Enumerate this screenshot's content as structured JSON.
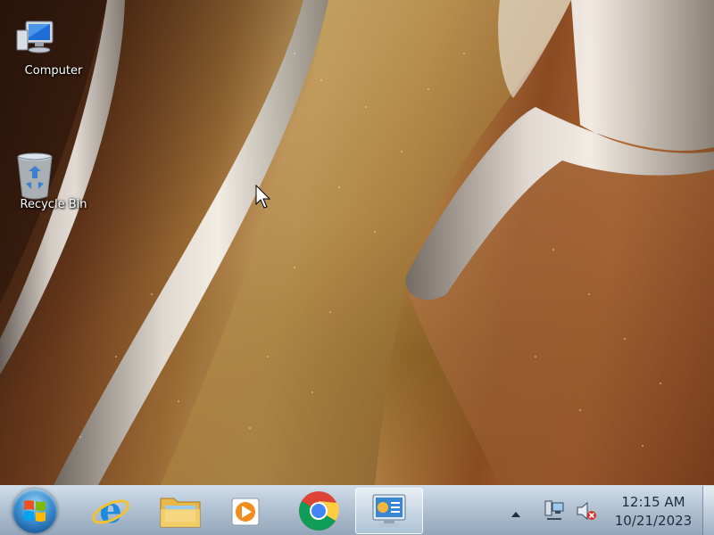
{
  "desktop": {
    "icons": [
      {
        "label": "Computer",
        "icon": "computer-icon"
      },
      {
        "label": "Recycle Bin",
        "icon": "recycle-bin-icon"
      }
    ]
  },
  "taskbar": {
    "start_button": "start-orb",
    "pinned": [
      {
        "name": "Internet Explorer",
        "icon": "internet-explorer-icon"
      },
      {
        "name": "Windows Explorer",
        "icon": "folder-icon"
      },
      {
        "name": "Windows Media Player",
        "icon": "media-player-icon"
      },
      {
        "name": "Google Chrome",
        "icon": "chrome-icon"
      },
      {
        "name": "Control Panel",
        "icon": "control-panel-icon",
        "active": true
      }
    ],
    "tray": {
      "icons": [
        "show-hidden-icons-arrow",
        "network-icon",
        "volume-muted-icon"
      ]
    },
    "clock": {
      "time": "12:15 AM",
      "date": "10/21/2023"
    }
  },
  "colors": {
    "taskbar": "#a9bccd",
    "clock_text": "#1e2c3d",
    "desktop_label": "#ffffff"
  }
}
